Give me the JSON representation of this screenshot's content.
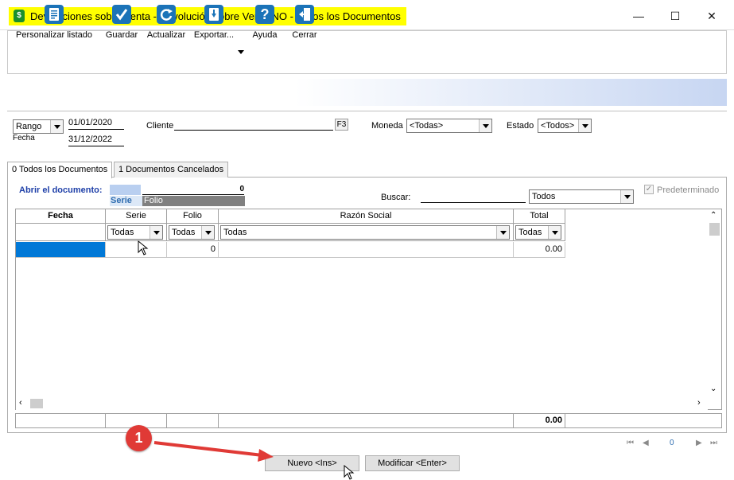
{
  "window": {
    "title": "Devoluciones sobre Venta - Devolución sobre Venta NO - Todos los Documentos",
    "app_icon_glyph": "$",
    "minimize": "—",
    "maximize": "☐",
    "close": "✕"
  },
  "toolbar": {
    "personalizar": "Personalizar listado",
    "guardar": "Guardar",
    "actualizar": "Actualizar",
    "exportar": "Exportar...",
    "ayuda": "Ayuda",
    "cerrar": "Cerrar"
  },
  "filters": {
    "rango_label": "Rango",
    "fecha_label": "Fecha",
    "date_from": "01/01/2020",
    "date_to": "31/12/2022",
    "cliente_label": "Cliente",
    "cliente_value": "",
    "f3_label": "F3",
    "moneda_label": "Moneda",
    "moneda_value": "<Todas>",
    "estado_label": "Estado",
    "estado_value": "<Todos>"
  },
  "tabs": [
    {
      "label": "0 Todos los Documentos"
    },
    {
      "label": "1 Documentos Cancelados"
    }
  ],
  "open_doc": {
    "label": "Abrir el documento:",
    "value": "0",
    "serie_label": "Serie",
    "folio_label": "Folio"
  },
  "search": {
    "label": "Buscar:",
    "value": "",
    "scope": "Todos",
    "predeterminado_label": "Predeterminado",
    "predeterminado_checked": true
  },
  "grid": {
    "columns": [
      "Fecha",
      "Serie",
      "Folio",
      "Razón Social",
      "Total"
    ],
    "filters": {
      "serie": "Todas",
      "folio": "Todas",
      "razon": "Todas",
      "total": "Todas"
    },
    "rows": [
      {
        "fecha": "",
        "serie": "",
        "folio": "0",
        "razon": "",
        "total": "0.00"
      }
    ],
    "footer_total": "0.00"
  },
  "navigation": {
    "first": "⏮",
    "prev": "◀",
    "page": "0",
    "next": "▶",
    "last": "⏭"
  },
  "buttons": {
    "nuevo": "Nuevo <Ins>",
    "modificar": "Modificar <Enter>"
  },
  "annotation": {
    "marker_label": "1"
  },
  "colors": {
    "title_highlight": "#ffff00",
    "accent_blue": "#1b73b8",
    "open_doc_label": "#1e3fa8",
    "marker": "#e03a36"
  }
}
